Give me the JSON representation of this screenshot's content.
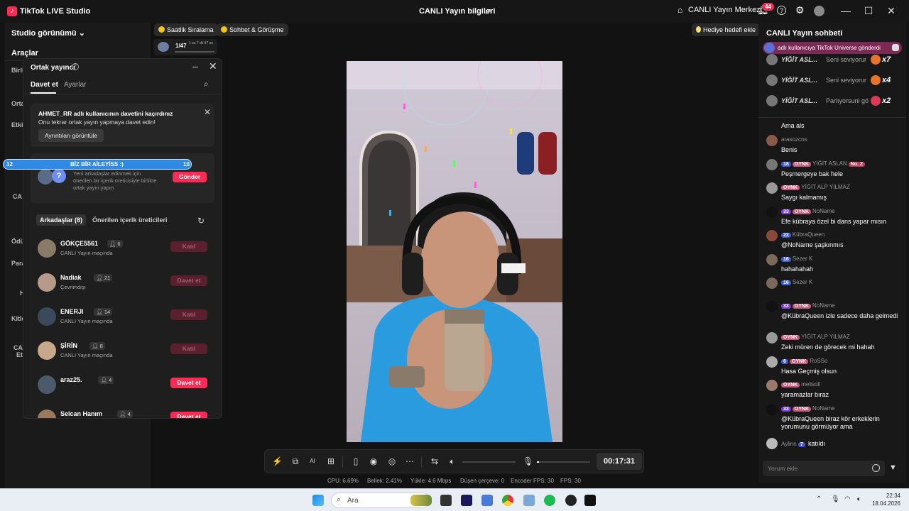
{
  "titlebar": {
    "app_title": "TikTok LIVE Studio",
    "center_title": "CANLI Yayın bilgileri",
    "live_center": "CANLI Yayın Merkezi",
    "notif_count": "44"
  },
  "left": {
    "studio_view": "Studio görünümü",
    "tools": "Araçlar",
    "fragments": [
      "Birli",
      "Orta",
      "Etki",
      "CA",
      "Ödü",
      "Para",
      "H",
      "Kitle",
      "CAI",
      "Et"
    ]
  },
  "top_pills": {
    "hourly": "Saatlik Sıralama",
    "chat_meet": "Sohbet & Görüşme",
    "rank": "1/47",
    "rank_time": "1 sa 7 dk 57 sn",
    "gift_goal": "Hediye hedefi ekle"
  },
  "guest": {
    "title": "Ortak yayıncı",
    "tab_invite": "Davet et",
    "tab_settings": "Ayarlar",
    "missed_title": "AHMET_RR adlı kullanıcının davetini kaçırdınız",
    "missed_sub": "Onu tekrar ortak yayın yapmaya davet edin!",
    "missed_btn": "Ayrıntıları görüntüle",
    "suggest_text": "Yeni arkadaşlar edinmek için önerilen bir içerik üreticisiyle birlikte ortak yayın yapın",
    "send_btn": "Gönder",
    "friends_tab": "Arkadaşlar (8)",
    "suggested_tab": "Önerilen içerik üreticileri",
    "friends": [
      {
        "name": "GÖKÇE5561",
        "count": "6",
        "status": "CANLI Yayın maçında",
        "button": "Katıl",
        "style": "dim",
        "color": "#8a7a6a"
      },
      {
        "name": "Nadiak",
        "count": "21",
        "status": "Çevrimdışı",
        "button": "Davet et",
        "style": "dim",
        "color": "#b89a8a"
      },
      {
        "name": "ENERJI",
        "count": "14",
        "status": "CANLI Yayın maçında",
        "button": "Katıl",
        "style": "dim",
        "color": "#3a4a5a"
      },
      {
        "name": "ŞİRİN",
        "count": "8",
        "status": "CANLI Yayın maçında",
        "button": "Katıl",
        "style": "dim",
        "color": "#c8a88a"
      },
      {
        "name": "araz25.",
        "count": "4",
        "status": "",
        "button": "Davet et",
        "style": "active",
        "color": "#4a5a6a"
      },
      {
        "name": "Selcan Hanım",
        "count": "4",
        "status": "",
        "button": "Davet et",
        "style": "active",
        "color": "#9a7a5a"
      }
    ]
  },
  "leaderboard": {
    "left": "12",
    "center": "BİZ BİR AİLEYİSS :)",
    "right": "10"
  },
  "controls": {
    "timer": "00:17:31"
  },
  "stats": {
    "cpu": "CPU: 6.69%",
    "mem": "Bellek: 2.41%",
    "upload": "Yükle: 4.6 Mbps",
    "dropped": "Düşen çerçeve: 0",
    "encoder": "Encoder FPS: 30",
    "fps": "FPS: 30"
  },
  "chat": {
    "title": "CANLI Yayın sohbeti",
    "gift_banner": "adlı kullanıcıya TikTok Universe gönderdi",
    "gifts": [
      {
        "name": "YİĞİT ASL...",
        "text": "Seni seviyorur",
        "mult": "x7",
        "color": "#e8742a"
      },
      {
        "name": "YİĞİT ASL...",
        "text": "Seni seviyorur",
        "mult": "x4",
        "color": "#e8742a"
      },
      {
        "name": "YİĞİT ASL...",
        "text": "Parlıyorsunl gö",
        "mult": "x2",
        "color": "#d83a5a"
      }
    ],
    "messages": [
      {
        "meta": "",
        "level": "",
        "fan": "",
        "user": "",
        "body": "Ama als"
      },
      {
        "meta": "arasozcns",
        "level": "",
        "fan": "",
        "user": "arasozcns",
        "body": "Benis"
      },
      {
        "level": "18",
        "fan": "OYNK",
        "user": "YİĞİT ASLAN",
        "extra": "No. 2",
        "body": "Peşmergeye bak hele"
      },
      {
        "level": "",
        "fan": "OYNK",
        "user": "YİĞİT ALP YILMAZ",
        "body": "Saygı kalmamış"
      },
      {
        "level": "33",
        "fan": "OYNK",
        "user": "NoName",
        "body": "Efe kübraya özel bi dans yapar mısın"
      },
      {
        "level": "22",
        "fan": "",
        "user": "KübraQueen",
        "body": "@NoName şaşkınmıs"
      },
      {
        "level": "16",
        "fan": "",
        "user": "Sezer K",
        "body": "hahahahah"
      },
      {
        "level": "16",
        "fan": "",
        "user": "Sezer K",
        "body": ""
      },
      {
        "level": "33",
        "fan": "OYNK",
        "user": "NoName",
        "body": "@KübraQueen izle sadece daha gelmedi"
      },
      {
        "level": "",
        "fan": "OYNK",
        "user": "YİĞİT ALP YILMAZ",
        "body": "Zeki müren de görecek mi hahah"
      },
      {
        "level": "6",
        "fan": "OYNK",
        "user": "RoSSo",
        "body": "Hasa Geçmiş olsun"
      },
      {
        "level": "",
        "fan": "OYNK",
        "user": "melisoll",
        "body": "yaramazlar bıraz"
      },
      {
        "level": "33",
        "fan": "OYNK",
        "user": "NoName",
        "body": "@KübraQueen biraz kör erkeklerin yorumunu görmüyor ama"
      },
      {
        "level": "7",
        "fan": "",
        "user": "Aylinn",
        "body": "katıldı"
      }
    ],
    "input_placeholder": "Yorum ekle"
  },
  "taskbar": {
    "search": "Ara",
    "time": "22:34",
    "date": "18.04.2026"
  }
}
